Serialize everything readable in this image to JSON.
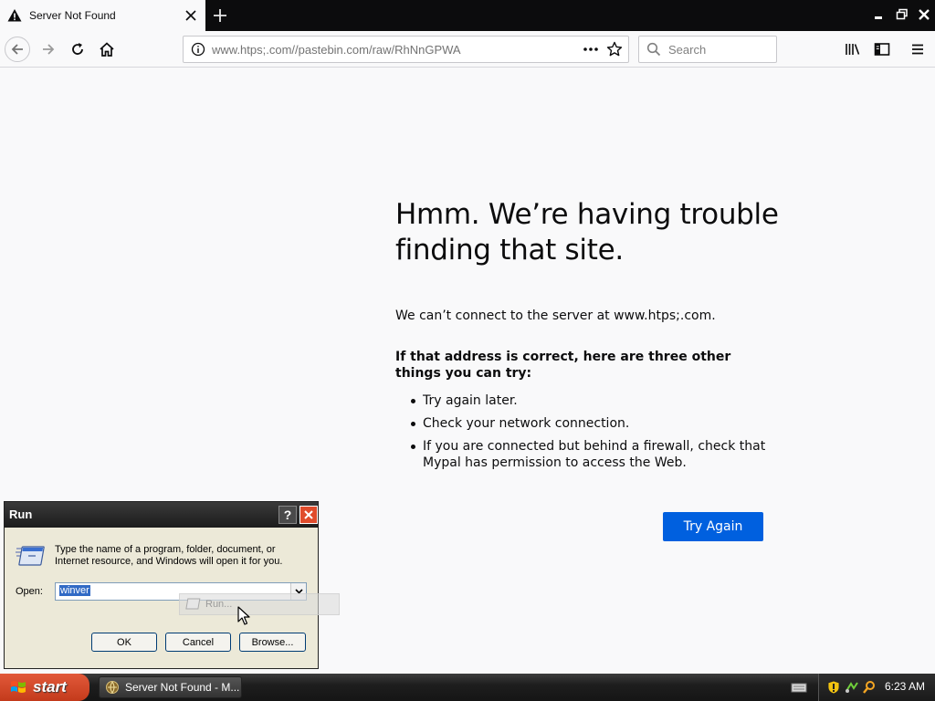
{
  "browser": {
    "tab_title": "Server Not Found",
    "url": "www.htps;.com//pastebin.com/raw/RhNnGPWA",
    "search_placeholder": "Search"
  },
  "error_page": {
    "title": "Hmm. We’re having trouble finding that site.",
    "message": "We can’t connect to the server at www.htps;.com.",
    "suggestion_heading": "If that address is correct, here are three other things you can try:",
    "suggestions": [
      "Try again later.",
      "Check your network connection.",
      "If you are connected but behind a firewall, check that Mypal has permission to access the Web."
    ],
    "try_again_label": "Try Again"
  },
  "run_dialog": {
    "title": "Run",
    "help_label": "?",
    "description": "Type the name of a program, folder, document, or Internet resource, and Windows will open it for you.",
    "open_label": "Open:",
    "open_value": "winver",
    "ok_label": "OK",
    "cancel_label": "Cancel",
    "browse_label": "Browse...",
    "ghost_label": "Run..."
  },
  "taskbar": {
    "start_label": "start",
    "task_label": "Server Not Found - M...",
    "clock": "6:23 AM"
  },
  "colors": {
    "accent": "#0060df",
    "page_bg": "#f9f9fa",
    "titlebar": "#0c0c0d",
    "start_red": "#d44a2a"
  }
}
